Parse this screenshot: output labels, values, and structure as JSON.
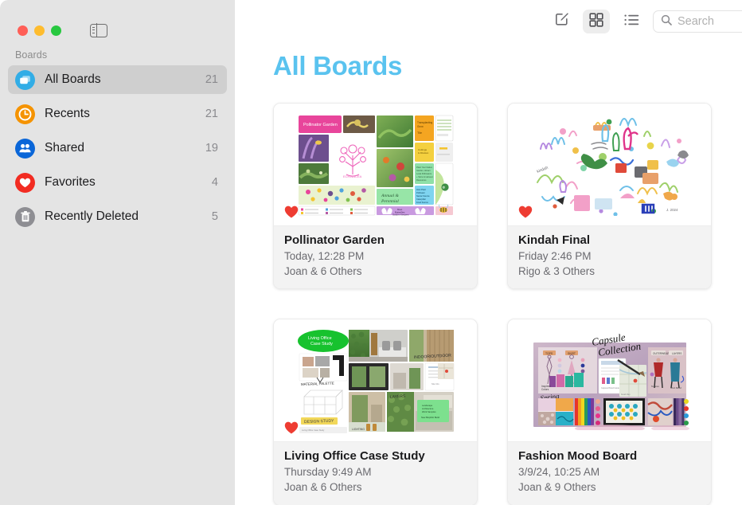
{
  "window": {
    "traffic_lights": [
      {
        "name": "close",
        "color": "#ff5f57"
      },
      {
        "name": "minimize",
        "color": "#febc2e"
      },
      {
        "name": "zoom",
        "color": "#28c840"
      }
    ],
    "sidebar_toggle_icon": "sidebar-toggle-icon"
  },
  "sidebar": {
    "header": "Boards",
    "items": [
      {
        "label": "All Boards",
        "count": "21",
        "icon": "boards-stack-icon",
        "color": "#32ade6",
        "selected": true
      },
      {
        "label": "Recents",
        "count": "21",
        "icon": "clock-icon",
        "color": "#f59300",
        "selected": false
      },
      {
        "label": "Shared",
        "count": "19",
        "icon": "people-icon",
        "color": "#0a66d8",
        "selected": false
      },
      {
        "label": "Favorites",
        "count": "4",
        "icon": "heart-icon",
        "color": "#f22c22",
        "selected": false
      },
      {
        "label": "Recently Deleted",
        "count": "5",
        "icon": "trash-icon",
        "color": "#8e8e93",
        "selected": false
      }
    ]
  },
  "toolbar": {
    "compose_label": "compose-icon",
    "grid_view_label": "grid-view-icon",
    "list_view_label": "list-view-icon",
    "grid_view_selected": true,
    "search": {
      "placeholder": "Search",
      "value": "",
      "icon": "search-icon"
    }
  },
  "main": {
    "title": "All Boards",
    "title_color": "#5ac3ef",
    "boards": [
      {
        "title": "Pollinator Garden",
        "date": "Today, 12:28 PM",
        "people": "Joan & 6 Others",
        "favorite": true,
        "thumbnail": "pollinator-garden-collage"
      },
      {
        "title": "Kindah Final",
        "date": "Friday 2:46 PM",
        "people": "Rigo & 3 Others",
        "favorite": true,
        "thumbnail": "kindah-final-doodles"
      },
      {
        "title": "Living Office Case Study",
        "date": "Thursday 9:49 AM",
        "people": "Joan & 6 Others",
        "favorite": true,
        "thumbnail": "living-office-collage"
      },
      {
        "title": "Fashion Mood Board",
        "date": "3/9/24, 10:25 AM",
        "people": "Joan & 9 Others",
        "favorite": false,
        "thumbnail": "fashion-mood-board-collage"
      }
    ]
  }
}
